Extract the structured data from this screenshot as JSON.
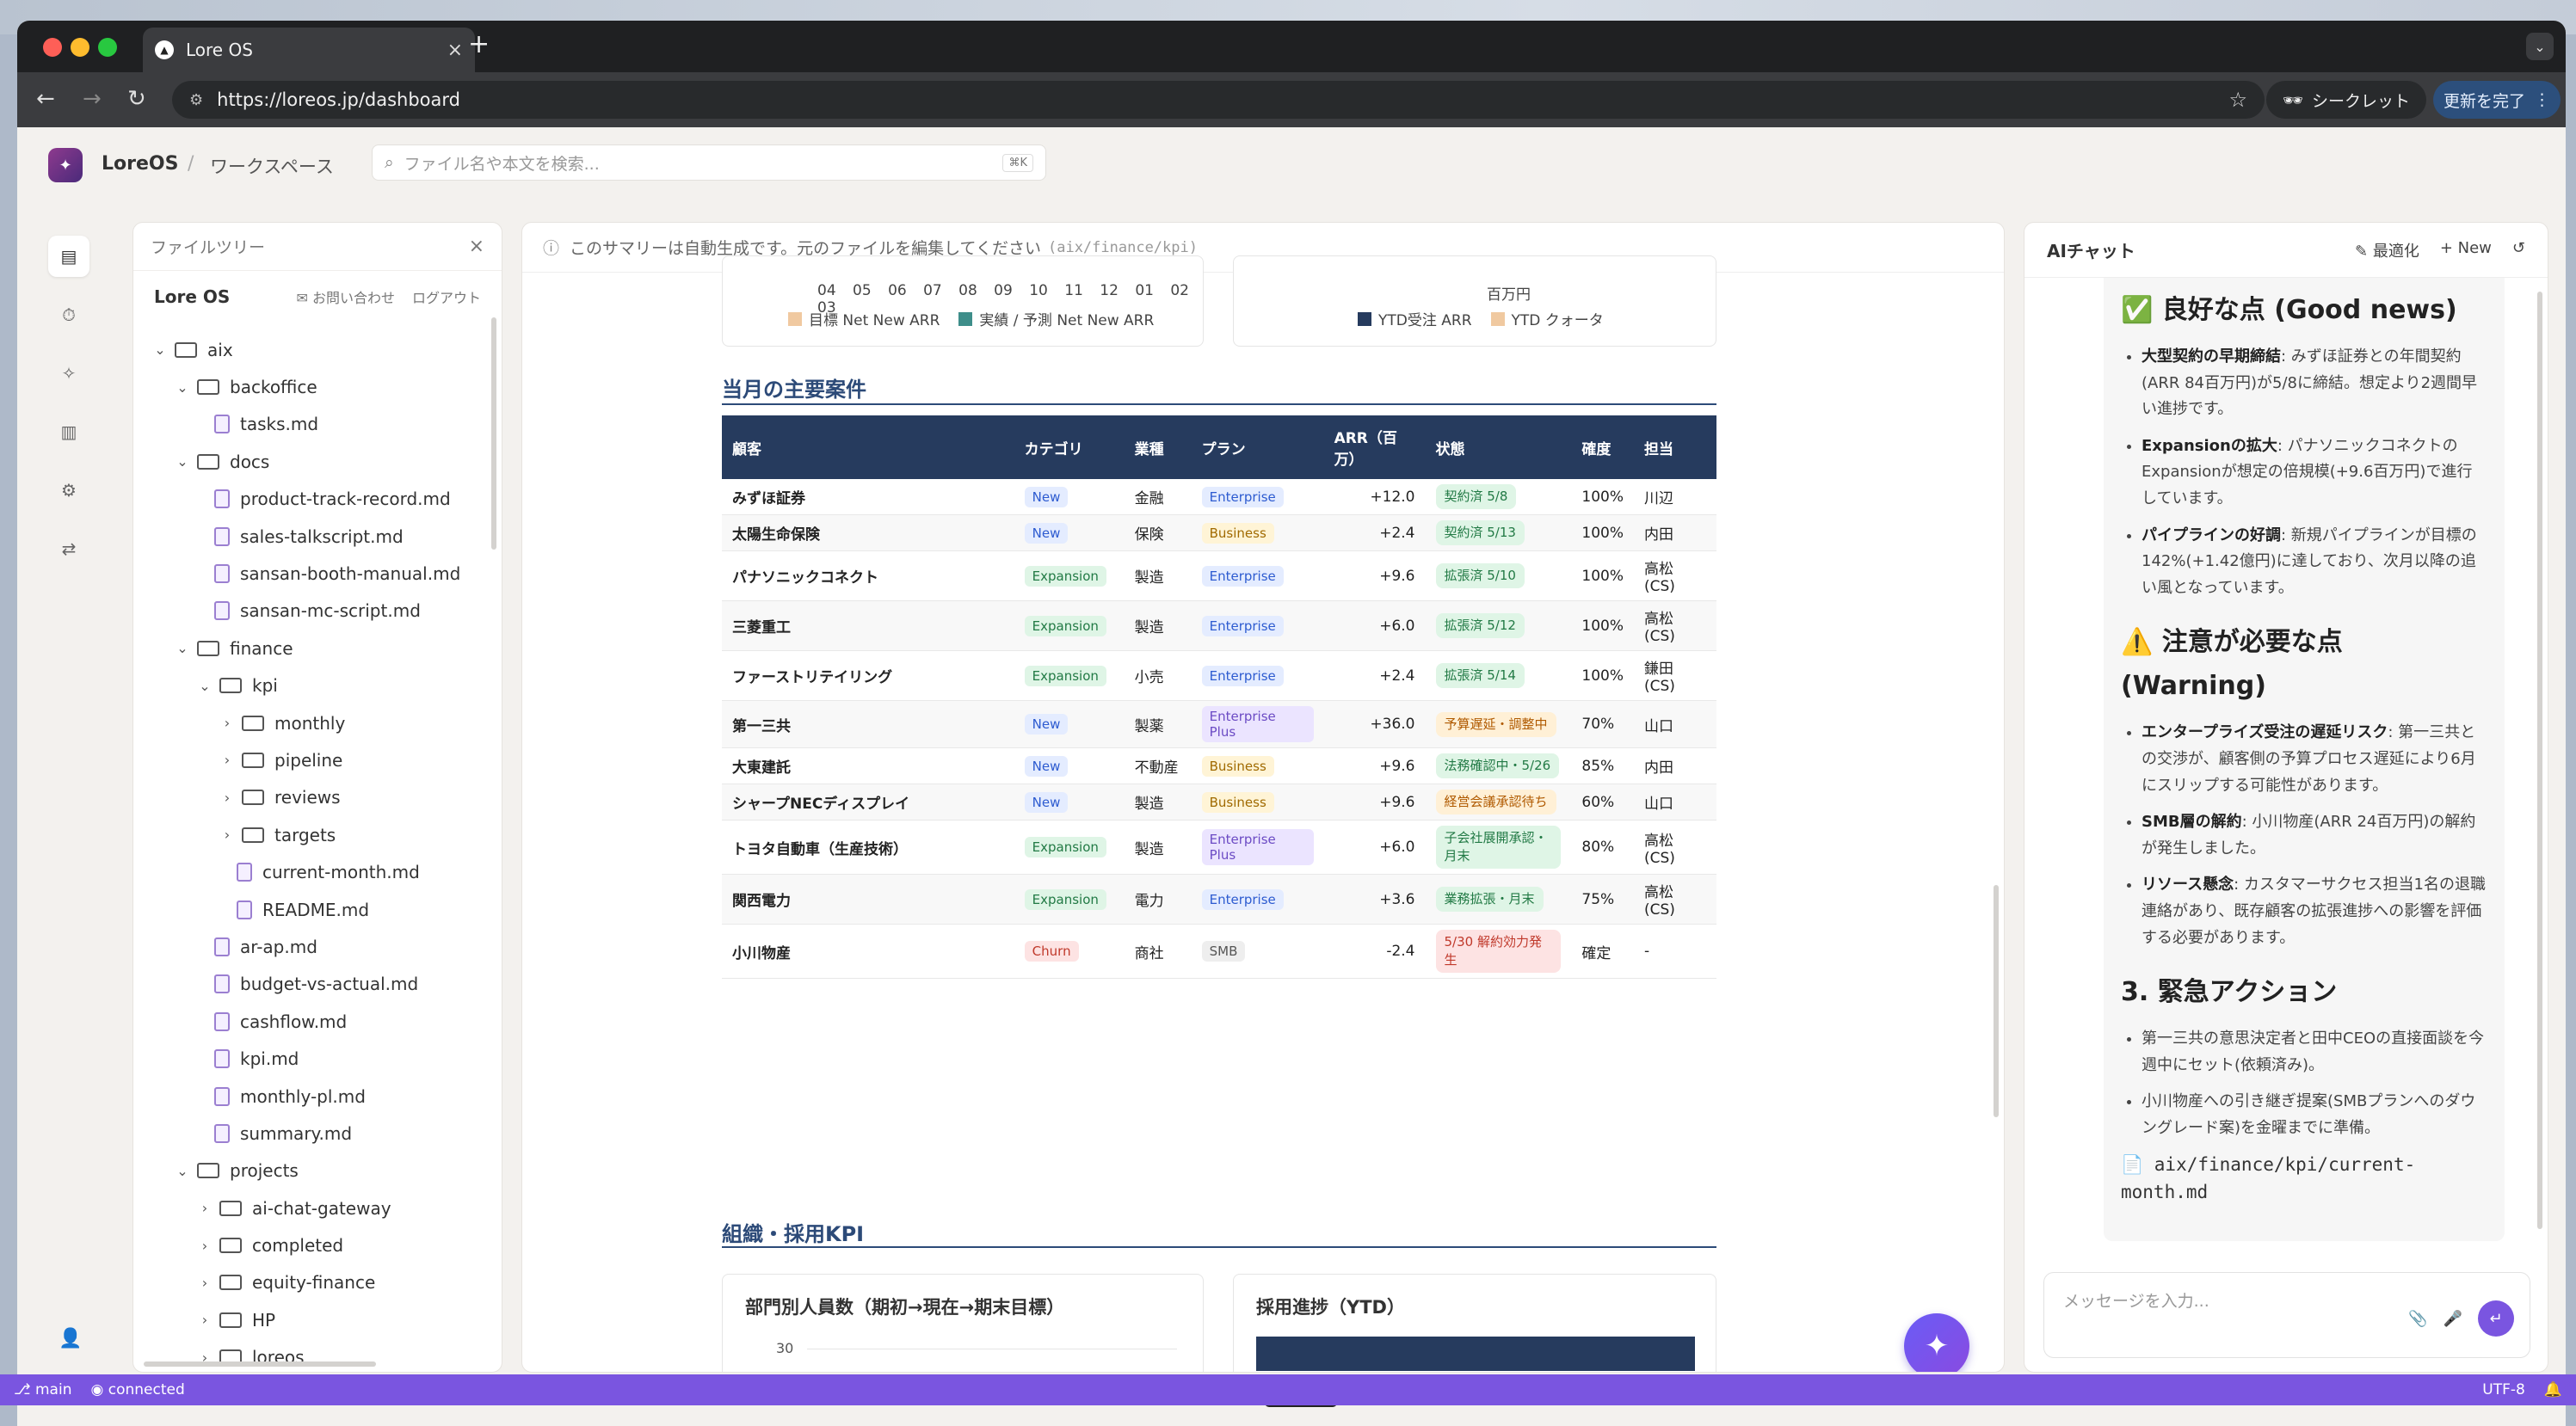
{
  "browser": {
    "tab_title": "Lore OS",
    "url": "https://loreos.jp/dashboard",
    "secret_label": "シークレット",
    "update_label": "更新を完了"
  },
  "app": {
    "brand": "LoreOS",
    "separator": "/",
    "workspace": "ワークスペース",
    "search_placeholder": "ファイル名や本文を検索...",
    "search_shortcut": "⌘K"
  },
  "tree": {
    "header": "ファイルツリー",
    "title": "Lore OS",
    "contact": "お問い合わせ",
    "logout": "ログアウト",
    "items": [
      {
        "label": "aix",
        "type": "folder",
        "depth": 0,
        "open": true
      },
      {
        "label": "backoffice",
        "type": "folder",
        "depth": 1,
        "open": true
      },
      {
        "label": "tasks.md",
        "type": "file",
        "depth": 2
      },
      {
        "label": "docs",
        "type": "folder",
        "depth": 1,
        "open": true
      },
      {
        "label": "product-track-record.md",
        "type": "file",
        "depth": 2
      },
      {
        "label": "sales-talkscript.md",
        "type": "file",
        "depth": 2
      },
      {
        "label": "sansan-booth-manual.md",
        "type": "file",
        "depth": 2
      },
      {
        "label": "sansan-mc-script.md",
        "type": "file",
        "depth": 2
      },
      {
        "label": "finance",
        "type": "folder",
        "depth": 1,
        "open": true
      },
      {
        "label": "kpi",
        "type": "folder",
        "depth": 2,
        "open": true
      },
      {
        "label": "monthly",
        "type": "folder",
        "depth": 3,
        "open": false
      },
      {
        "label": "pipeline",
        "type": "folder",
        "depth": 3,
        "open": false
      },
      {
        "label": "reviews",
        "type": "folder",
        "depth": 3,
        "open": false
      },
      {
        "label": "targets",
        "type": "folder",
        "depth": 3,
        "open": false
      },
      {
        "label": "current-month.md",
        "type": "file",
        "depth": 3
      },
      {
        "label": "README.md",
        "type": "file",
        "depth": 3
      },
      {
        "label": "ar-ap.md",
        "type": "file",
        "depth": 2
      },
      {
        "label": "budget-vs-actual.md",
        "type": "file",
        "depth": 2
      },
      {
        "label": "cashflow.md",
        "type": "file",
        "depth": 2
      },
      {
        "label": "kpi.md",
        "type": "file",
        "depth": 2
      },
      {
        "label": "monthly-pl.md",
        "type": "file",
        "depth": 2
      },
      {
        "label": "summary.md",
        "type": "file",
        "depth": 2
      },
      {
        "label": "projects",
        "type": "folder",
        "depth": 1,
        "open": true
      },
      {
        "label": "ai-chat-gateway",
        "type": "folder",
        "depth": 2,
        "open": false
      },
      {
        "label": "completed",
        "type": "folder",
        "depth": 2,
        "open": false
      },
      {
        "label": "equity-finance",
        "type": "folder",
        "depth": 2,
        "open": false
      },
      {
        "label": "HP",
        "type": "folder",
        "depth": 2,
        "open": false
      },
      {
        "label": "loreos",
        "type": "folder",
        "depth": 2,
        "open": false
      }
    ]
  },
  "main": {
    "notice": "このサマリーは自動生成です。元のファイルを編集してください",
    "notice_path": "(aix/finance/kpi)",
    "chart_top": {
      "months": "04 05 06 07 08 09 10 11 12 01 02 03",
      "legend_left": [
        "目標 Net New ARR",
        "実績 / 予測 Net New ARR"
      ],
      "unit_right": "百万円",
      "legend_right": [
        "YTD受注 ARR",
        "YTD クォータ"
      ]
    },
    "deals_title": "当月の主要案件",
    "deals_headers": [
      "顧客",
      "カテゴリ",
      "業種",
      "プラン",
      "ARR（百万）",
      "状態",
      "確度",
      "担当"
    ],
    "deals": [
      {
        "customer": "みずほ証券",
        "cat": "New",
        "ind": "金融",
        "plan": "Enterprise",
        "arr": "+12.0",
        "status": "契約済 5/8",
        "prob": "100%",
        "owner": "川辺"
      },
      {
        "customer": "太陽生命保険",
        "cat": "New",
        "ind": "保険",
        "plan": "Business",
        "arr": "+2.4",
        "status": "契約済 5/13",
        "prob": "100%",
        "owner": "内田"
      },
      {
        "customer": "パナソニックコネクト",
        "cat": "Expansion",
        "ind": "製造",
        "plan": "Enterprise",
        "arr": "+9.6",
        "status": "拡張済 5/10",
        "prob": "100%",
        "owner": "高松 (CS)"
      },
      {
        "customer": "三菱重工",
        "cat": "Expansion",
        "ind": "製造",
        "plan": "Enterprise",
        "arr": "+6.0",
        "status": "拡張済 5/12",
        "prob": "100%",
        "owner": "高松 (CS)"
      },
      {
        "customer": "ファーストリテイリング",
        "cat": "Expansion",
        "ind": "小売",
        "plan": "Enterprise",
        "arr": "+2.4",
        "status": "拡張済 5/14",
        "prob": "100%",
        "owner": "鎌田 (CS)"
      },
      {
        "customer": "第一三共",
        "cat": "New",
        "ind": "製薬",
        "plan": "Enterprise Plus",
        "arr": "+36.0",
        "status": "予算遅延・調整中",
        "prob": "70%",
        "owner": "山口"
      },
      {
        "customer": "大東建託",
        "cat": "New",
        "ind": "不動産",
        "plan": "Business",
        "arr": "+9.6",
        "status": "法務確認中・5/26",
        "prob": "85%",
        "owner": "内田"
      },
      {
        "customer": "シャープNECディスプレイ",
        "cat": "New",
        "ind": "製造",
        "plan": "Business",
        "arr": "+9.6",
        "status": "経営会議承認待ち",
        "prob": "60%",
        "owner": "山口"
      },
      {
        "customer": "トヨタ自動車（生産技術）",
        "cat": "Expansion",
        "ind": "製造",
        "plan": "Enterprise Plus",
        "arr": "+6.0",
        "status": "子会社展開承認・月末",
        "prob": "80%",
        "owner": "高松 (CS)"
      },
      {
        "customer": "関西電力",
        "cat": "Expansion",
        "ind": "電力",
        "plan": "Enterprise",
        "arr": "+3.6",
        "status": "業務拡張・月末",
        "prob": "75%",
        "owner": "高松 (CS)"
      },
      {
        "customer": "小川物産",
        "cat": "Churn",
        "ind": "商社",
        "plan": "SMB",
        "arr": "-2.4",
        "status": "5/30 解約効力発生",
        "prob": "確定",
        "owner": "-"
      }
    ],
    "org_title": "組織・採用KPI",
    "org_card_left": "部門別人員数（期初→現在→期末目標）",
    "org_card_left_tick": "30",
    "org_card_right": "採用進捗（YTD）"
  },
  "chat": {
    "title": "AIチャット",
    "optimize": "最適化",
    "new": "New",
    "good_title": "✅ 良好な点 (Good news)",
    "good": [
      {
        "b": "大型契約の早期締結",
        "t": ": みずほ証券との年間契約(ARR 84百万円)が5/8に締結。想定より2週間早い進捗です。"
      },
      {
        "b": "Expansionの拡大",
        "t": ": パナソニックコネクトのExpansionが想定の倍規模(+9.6百万円)で進行しています。"
      },
      {
        "b": "パイプラインの好調",
        "t": ": 新規パイプラインが目標の142%(+1.42億円)に達しており、次月以降の追い風となっています。"
      }
    ],
    "warn_title": "⚠️ 注意が必要な点 (Warning)",
    "warn": [
      {
        "b": "エンタープライズ受注の遅延リスク",
        "t": ": 第一三共との交渉が、顧客側の予算プロセス遅延により6月にスリップする可能性があります。"
      },
      {
        "b": "SMB層の解約",
        "t": ": 小川物産(ARR 24百万円)の解約が発生しました。"
      },
      {
        "b": "リソース懸念",
        "t": ": カスタマーサクセス担当1名の退職連絡があり、既存顧客の拡張進捗への影響を評価する必要があります。"
      }
    ],
    "action_title": "3. 緊急アクション",
    "actions": [
      "第一三共の意思決定者と田中CEOの直接面談を今週中にセット(依頼済み)。",
      "小川物産への引き継ぎ提案(SMBプランへのダウングレード案)を金曜までに準備。"
    ],
    "file_ref": "📄 aix/finance/kpi/current-month.md",
    "input_placeholder": "メッセージを入力..."
  },
  "status": {
    "branch": "main",
    "conn": "connected",
    "encoding": "UTF-8"
  }
}
